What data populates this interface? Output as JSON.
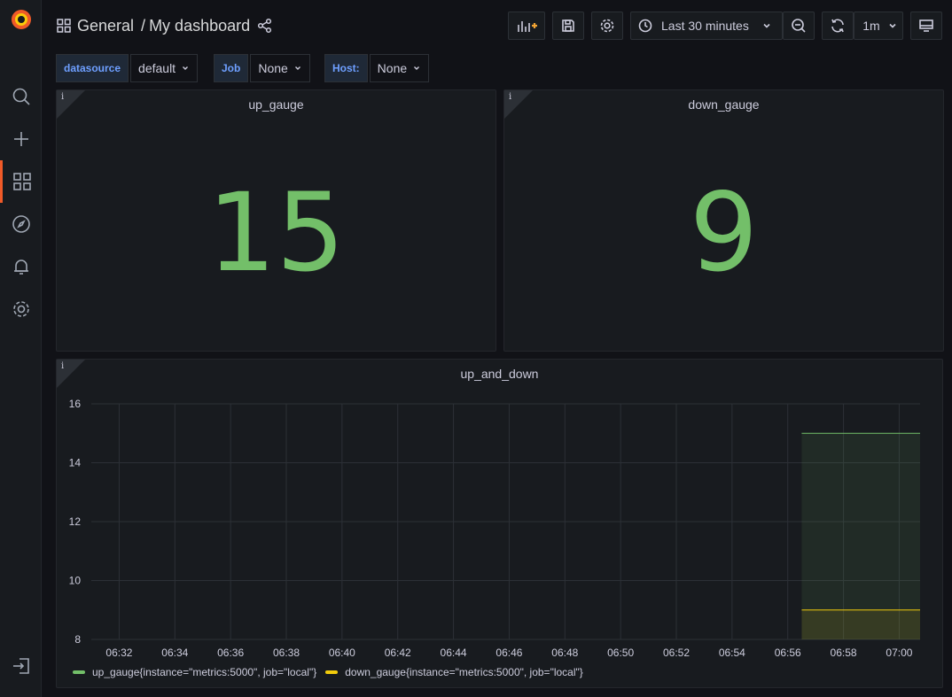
{
  "header": {
    "folder": "General",
    "separator": "/",
    "dashboard": "My dashboard"
  },
  "toolbar": {
    "time_range": "Last 30 minutes",
    "refresh_interval": "1m"
  },
  "variables": [
    {
      "label": "datasource",
      "value": "default"
    },
    {
      "label": "Job",
      "value": "None"
    },
    {
      "label": "Host:",
      "value": "None"
    }
  ],
  "panels": {
    "up_gauge": {
      "title": "up_gauge",
      "value": "15",
      "info": "i"
    },
    "down_gauge": {
      "title": "down_gauge",
      "value": "9",
      "info": "i"
    },
    "up_and_down": {
      "title": "up_and_down",
      "info": "i"
    }
  },
  "colors": {
    "up_series": "#73bf69",
    "down_series": "#f2cc0c",
    "brand": "#f05a28",
    "value_green": "#73bf69"
  },
  "chart_data": {
    "type": "line",
    "title": "up_and_down",
    "x_ticks": [
      "06:32",
      "06:34",
      "06:36",
      "06:38",
      "06:40",
      "06:42",
      "06:44",
      "06:46",
      "06:48",
      "06:50",
      "06:52",
      "06:54",
      "06:56",
      "06:58",
      "07:00"
    ],
    "y_ticks": [
      "16",
      "14",
      "12",
      "10",
      "8"
    ],
    "ylim": [
      8,
      16
    ],
    "xlim": [
      "06:31",
      "07:00:45"
    ],
    "grid": true,
    "legend_position": "bottom-left",
    "series": [
      {
        "name": "up_gauge{instance=\"metrics:5000\", job=\"local\"}",
        "x": [
          "06:56:30",
          "07:00:45"
        ],
        "values": [
          15,
          15
        ]
      },
      {
        "name": "down_gauge{instance=\"metrics:5000\", job=\"local\"}",
        "x": [
          "06:56:30",
          "07:00:45"
        ],
        "values": [
          9,
          9
        ]
      }
    ]
  }
}
